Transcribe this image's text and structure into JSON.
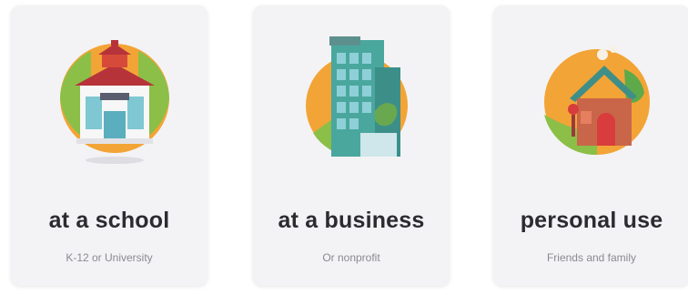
{
  "cards": [
    {
      "title": "at a school",
      "subtitle": "K-12 or University",
      "icon": "school-building-icon"
    },
    {
      "title": "at a business",
      "subtitle": "Or nonprofit",
      "icon": "office-building-icon"
    },
    {
      "title": "personal use",
      "subtitle": "Friends and family",
      "icon": "house-icon"
    }
  ],
  "colors": {
    "card_bg": "#f3f3f5",
    "title": "#2b2b30",
    "subtitle": "#8a8a90",
    "accent_orange": "#f3a436",
    "accent_teal": "#3fa9a0"
  }
}
